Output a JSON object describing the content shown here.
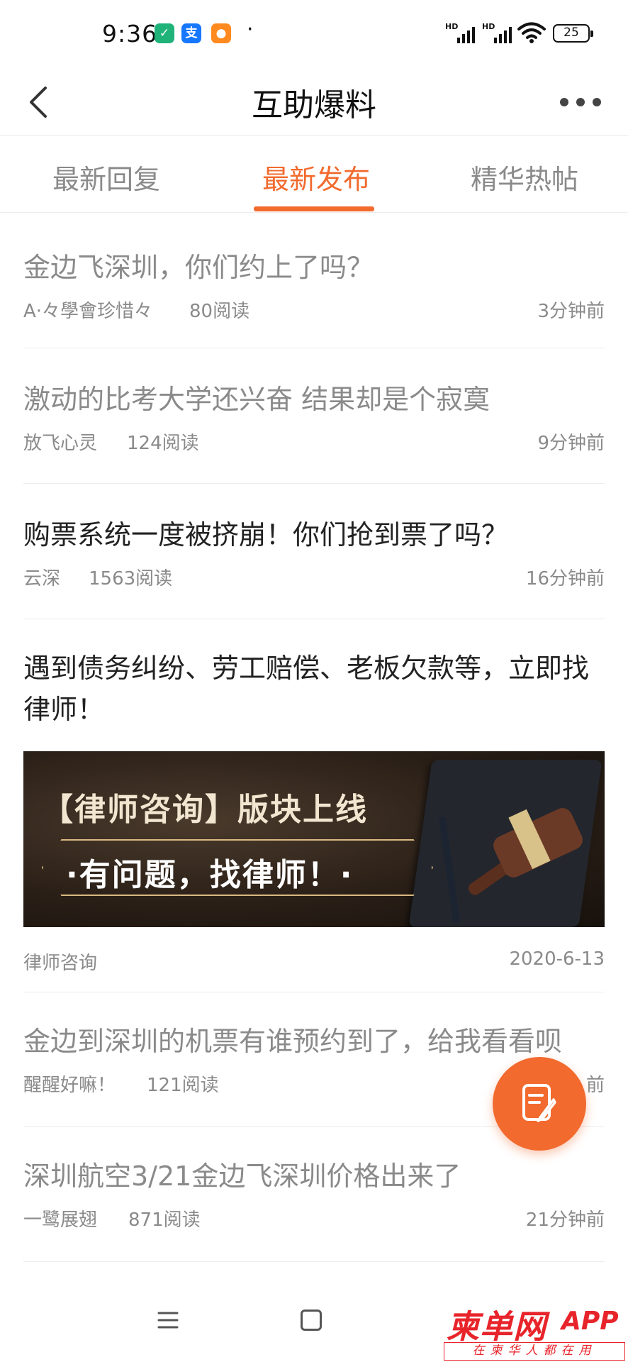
{
  "status_bar": {
    "time": "9:36",
    "dot": "·",
    "signal_label": "HD",
    "battery": "25",
    "icons": [
      "shield-app-icon",
      "alipay-icon",
      "lion-app-icon",
      "signal-icon",
      "signal-icon",
      "wifi-icon",
      "battery-icon"
    ]
  },
  "header": {
    "title": "互助爆料",
    "back_icon": "chevron-left-icon",
    "more_icon": "more-dots-icon"
  },
  "tabs": [
    {
      "label": "最新回复",
      "active": false
    },
    {
      "label": "最新发布",
      "active": true
    },
    {
      "label": "精华热帖",
      "active": false
    }
  ],
  "accent_color": "#f26a2e",
  "posts": [
    {
      "title": "金边飞深圳，你们约上了吗？",
      "author": "A·々學會珍惜々",
      "reads": "80阅读",
      "time": "3分钟前"
    },
    {
      "title": "激动的比考大学还兴奋 结果却是个寂寞",
      "author": "放飞心灵",
      "reads": "124阅读",
      "time": "9分钟前"
    },
    {
      "title": "购票系统一度被挤崩！你们抢到票了吗？",
      "author": "云深",
      "reads": "1563阅读",
      "time": "16分钟前"
    },
    {
      "title": "遇到债务纠纷、劳工赔偿、老板欠款等，立即找律师！",
      "author": "律师咨询",
      "time": "2020-6-13",
      "banner": {
        "line1": "【律师咨询】版块上线",
        "line2": "·有问题，找律师！·"
      }
    },
    {
      "title": "金边到深圳的机票有谁预约到了，给我看看呗",
      "author": "醒醒好嘛！",
      "reads": "121阅读",
      "time": "前"
    },
    {
      "title": "深圳航空3/21金边飞深圳价格出来了",
      "author": "一鹭展翅",
      "reads": "871阅读",
      "time": "21分钟前"
    }
  ],
  "fab": {
    "icon": "compose-icon"
  },
  "navbar": {
    "icons": [
      "menu-icon",
      "home-square-icon"
    ]
  },
  "watermark": {
    "logo": "柬单网",
    "app": "APP",
    "slogan": "在柬华人都在用"
  }
}
